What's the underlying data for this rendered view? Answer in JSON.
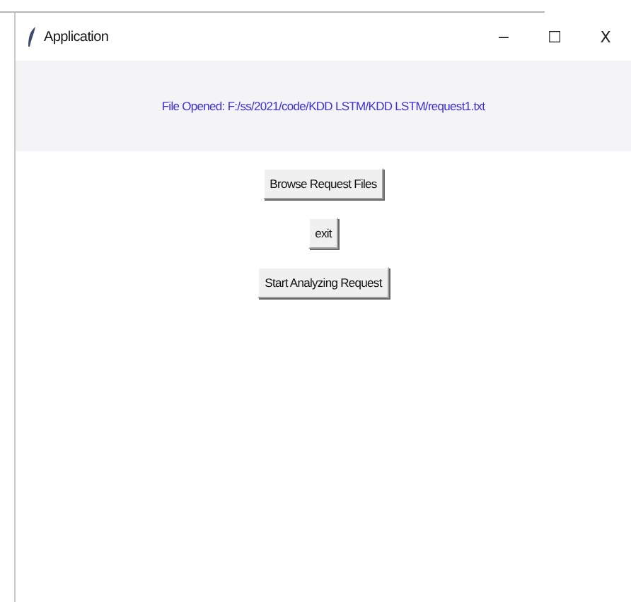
{
  "window": {
    "title": "Application",
    "controls": [
      "−",
      "☐",
      "X"
    ]
  },
  "file_label": "File Opened: F:/ss/2021/code/KDD LSTM/KDD LSTM/request1.txt",
  "buttons": [
    "Browse Request Files",
    "exit",
    "Start Analyzing Request"
  ]
}
